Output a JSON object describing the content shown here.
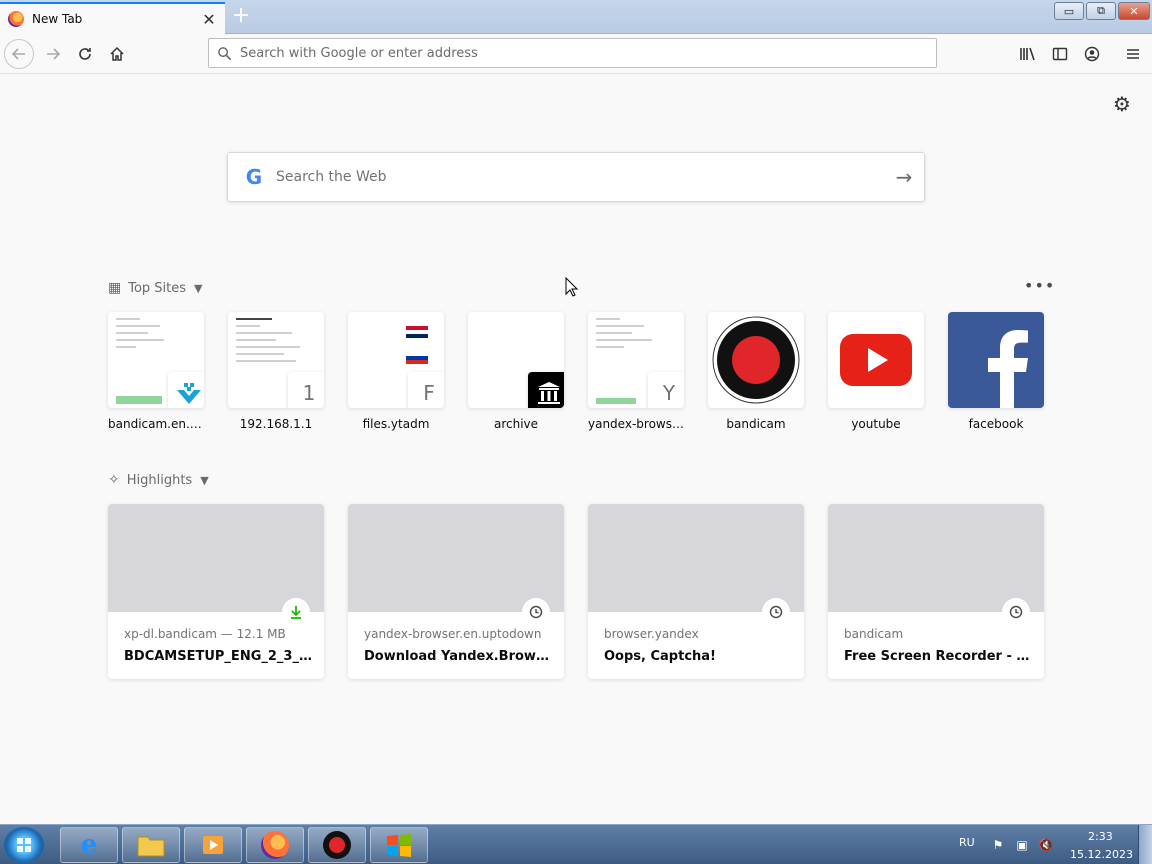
{
  "browser": {
    "tab_title": "New Tab",
    "tab_close": "✕",
    "new_tab": "+",
    "url_placeholder": "Search with Google or enter address"
  },
  "window_controls": {
    "minimize": "▭",
    "maximize": "⧉",
    "close": "✕"
  },
  "newtab": {
    "search_placeholder": "Search the Web",
    "top_sites_label": "Top Sites",
    "highlights_label": "Highlights",
    "more": "•••",
    "top_sites": [
      {
        "label": "bandicam.en.up...",
        "badge": "▼",
        "badge_color": "#1aa3d9"
      },
      {
        "label": "192.168.1.1",
        "badge": "1"
      },
      {
        "label": "files.ytadm",
        "badge": "F"
      },
      {
        "label": "archive",
        "badge": "🏛"
      },
      {
        "label": "yandex-browser....",
        "badge": "Y"
      },
      {
        "label": "bandicam"
      },
      {
        "label": "youtube"
      },
      {
        "label": "facebook"
      }
    ],
    "highlights": [
      {
        "host": "xp-dl.bandicam — 12.1 MB",
        "title": "BDCAMSETUP_ENG_2_3_1_...",
        "icon": "download-icon"
      },
      {
        "host": "yandex-browser.en.uptodown",
        "title": "Download Yandex.Browser ...",
        "icon": "clock-icon"
      },
      {
        "host": "browser.yandex",
        "title": "Oops, Captcha!",
        "icon": "clock-icon"
      },
      {
        "host": "bandicam",
        "title": "Free Screen Recorder - Ban...",
        "icon": "clock-icon"
      }
    ]
  },
  "taskbar": {
    "language": "RU",
    "time": "2:33",
    "date": "15.12.2023"
  },
  "colors": {
    "accent": "#0a84ff",
    "youtube": "#e62117",
    "facebook": "#3b5998",
    "download_green": "#12bc00"
  }
}
